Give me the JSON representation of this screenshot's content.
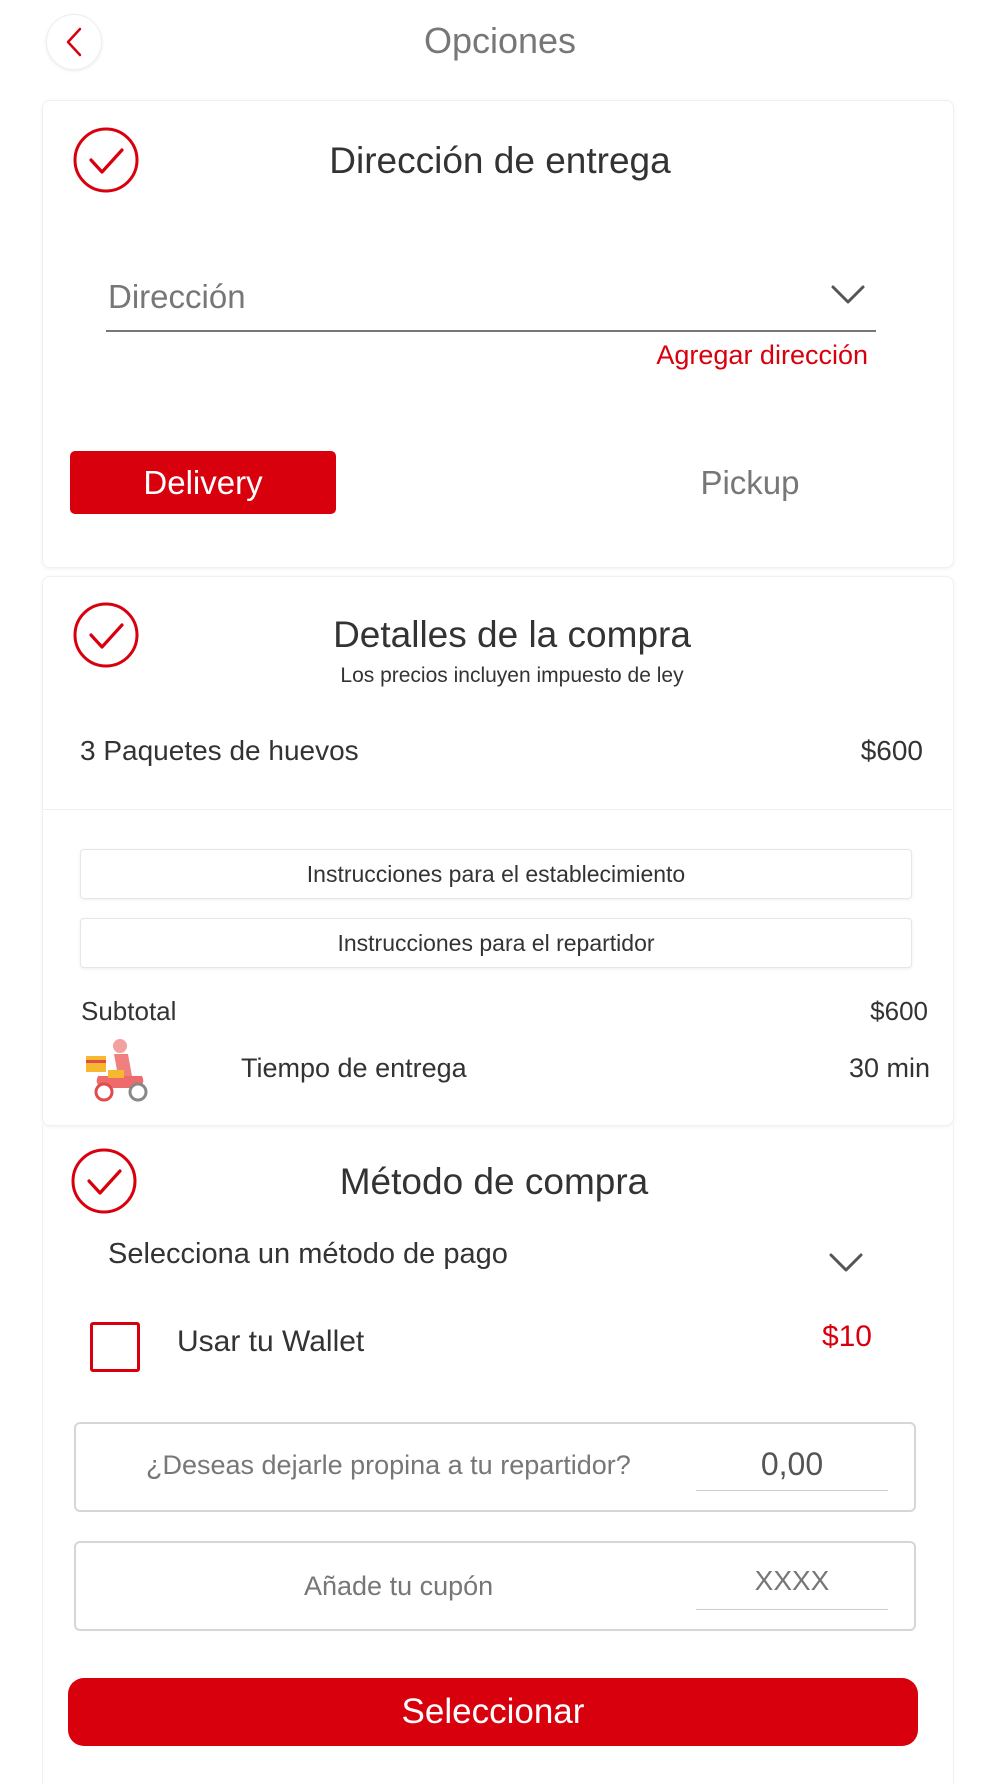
{
  "header": {
    "title": "Opciones"
  },
  "delivery_section": {
    "title": "Dirección de entrega",
    "address_placeholder": "Dirección",
    "add_address_link": "Agregar dirección",
    "modes": {
      "delivery": "Delivery",
      "pickup": "Pickup",
      "selected": "Delivery"
    }
  },
  "purchase_section": {
    "title": "Detalles de la compra",
    "subtitle": "Los precios incluyen impuesto de ley",
    "items": [
      {
        "name": "3 Paquetes de huevos",
        "price": "$600"
      }
    ],
    "instructions": {
      "establishment": "Instrucciones para el establecimiento",
      "courier": "Instrucciones para el repartidor"
    },
    "subtotal_label": "Subtotal",
    "subtotal_value": "$600",
    "delivery_time_label": "Tiempo de entrega",
    "delivery_time_value": "30 min"
  },
  "payment_section": {
    "title": "Método de compra",
    "payment_method_placeholder": "Selecciona un método de pago",
    "wallet_label": "Usar tu Wallet",
    "wallet_amount": "$10",
    "wallet_checked": false,
    "tip_prompt": "¿Deseas dejarle propina a tu repartidor?",
    "tip_value": "0,00",
    "coupon_label": "Añade tu cupón",
    "coupon_placeholder": "XXXX"
  },
  "submit_button": "Seleccionar",
  "colors": {
    "accent": "#d9000d",
    "muted_text": "#777777",
    "text": "#333333"
  },
  "icons": [
    "chevron-left-icon",
    "check-circle-icon",
    "chevron-down-icon",
    "delivery-scooter-icon"
  ]
}
